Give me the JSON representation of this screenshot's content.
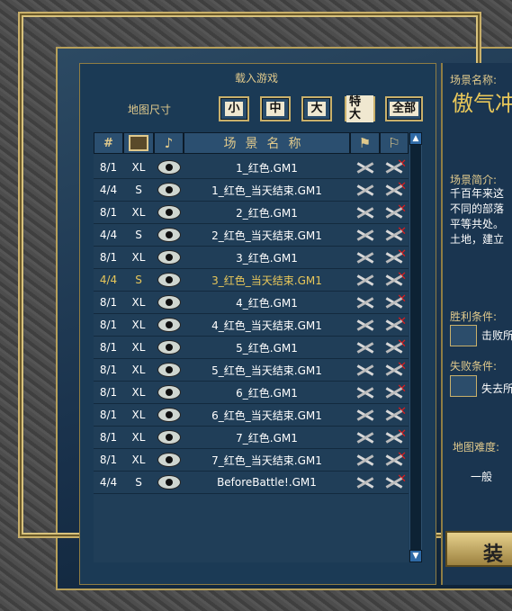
{
  "dialog": {
    "title": "载入游戏",
    "map_size_label": "地图尺寸",
    "size_buttons": [
      "小",
      "中",
      "大",
      "特大",
      "全部"
    ]
  },
  "list": {
    "header_name": "场景名称",
    "rows": [
      {
        "players": "8/1",
        "size": "XL",
        "name": "1_红色.GM1",
        "selected": false
      },
      {
        "players": "4/4",
        "size": "S",
        "name": "1_红色_当天结束.GM1",
        "selected": false
      },
      {
        "players": "8/1",
        "size": "XL",
        "name": "2_红色.GM1",
        "selected": false
      },
      {
        "players": "4/4",
        "size": "S",
        "name": "2_红色_当天结束.GM1",
        "selected": false
      },
      {
        "players": "8/1",
        "size": "XL",
        "name": "3_红色.GM1",
        "selected": false
      },
      {
        "players": "4/4",
        "size": "S",
        "name": "3_红色_当天结束.GM1",
        "selected": true
      },
      {
        "players": "8/1",
        "size": "XL",
        "name": "4_红色.GM1",
        "selected": false
      },
      {
        "players": "8/1",
        "size": "XL",
        "name": "4_红色_当天结束.GM1",
        "selected": false
      },
      {
        "players": "8/1",
        "size": "XL",
        "name": "5_红色.GM1",
        "selected": false
      },
      {
        "players": "8/1",
        "size": "XL",
        "name": "5_红色_当天结束.GM1",
        "selected": false
      },
      {
        "players": "8/1",
        "size": "XL",
        "name": "6_红色.GM1",
        "selected": false
      },
      {
        "players": "8/1",
        "size": "XL",
        "name": "6_红色_当天结束.GM1",
        "selected": false
      },
      {
        "players": "8/1",
        "size": "XL",
        "name": "7_红色.GM1",
        "selected": false
      },
      {
        "players": "8/1",
        "size": "XL",
        "name": "7_红色_当天结束.GM1",
        "selected": false
      },
      {
        "players": "4/4",
        "size": "S",
        "name": "BeforeBattle!.GM1",
        "selected": false
      }
    ]
  },
  "details": {
    "scene_name_label": "场景名称:",
    "scene_name": "傲气冲",
    "intro_label": "场景简介:",
    "intro_lines": [
      "千百年来这",
      "不同的部落",
      "平等共处。",
      "土地，建立"
    ],
    "victory_label": "胜利条件:",
    "victory_text": "击败所",
    "defeat_label": "失败条件:",
    "defeat_text": "失去所",
    "difficulty_label": "地图难度:",
    "difficulty": "一般",
    "load_button": "装"
  },
  "colors": {
    "accent_gold": "#e0c98c",
    "selected_row": "#e8c75a",
    "panel_blue": "#1b3a55"
  }
}
